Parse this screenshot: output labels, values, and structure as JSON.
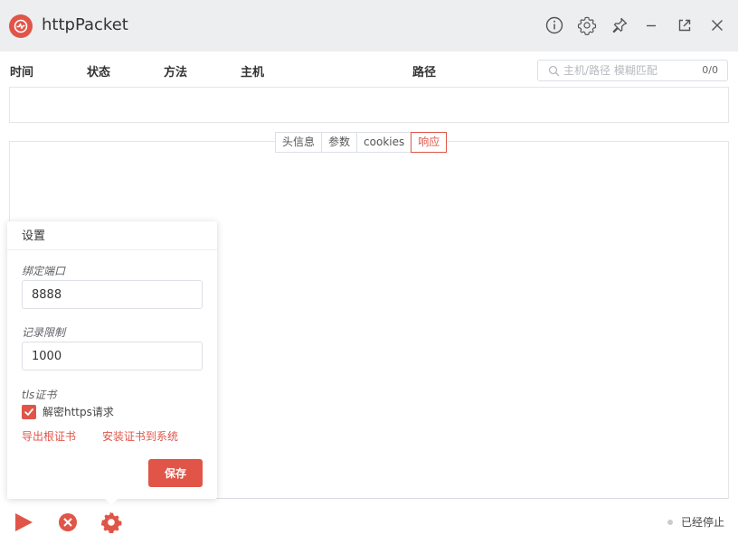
{
  "app": {
    "title": "httpPacket"
  },
  "columns": [
    "时间",
    "状态",
    "方法",
    "主机",
    "路径"
  ],
  "search": {
    "placeholder": "主机/路径 模糊匹配",
    "count": "0/0"
  },
  "detail_tabs": [
    {
      "label": "头信息",
      "active": false
    },
    {
      "label": "参数",
      "active": false
    },
    {
      "label": "cookies",
      "active": false
    },
    {
      "label": "响应",
      "active": true
    }
  ],
  "settings": {
    "title": "设置",
    "port_label": "绑定端口",
    "port_value": "8888",
    "limit_label": "记录限制",
    "limit_value": "1000",
    "tls_label": "tls证书",
    "decrypt_label": "解密https请求",
    "decrypt_checked": true,
    "export_link": "导出根证书",
    "install_link": "安装证书到系统",
    "save_label": "保存"
  },
  "status": {
    "text": "已经停止"
  },
  "colors": {
    "accent": "#e05548",
    "titlebar": "#eceef0"
  }
}
